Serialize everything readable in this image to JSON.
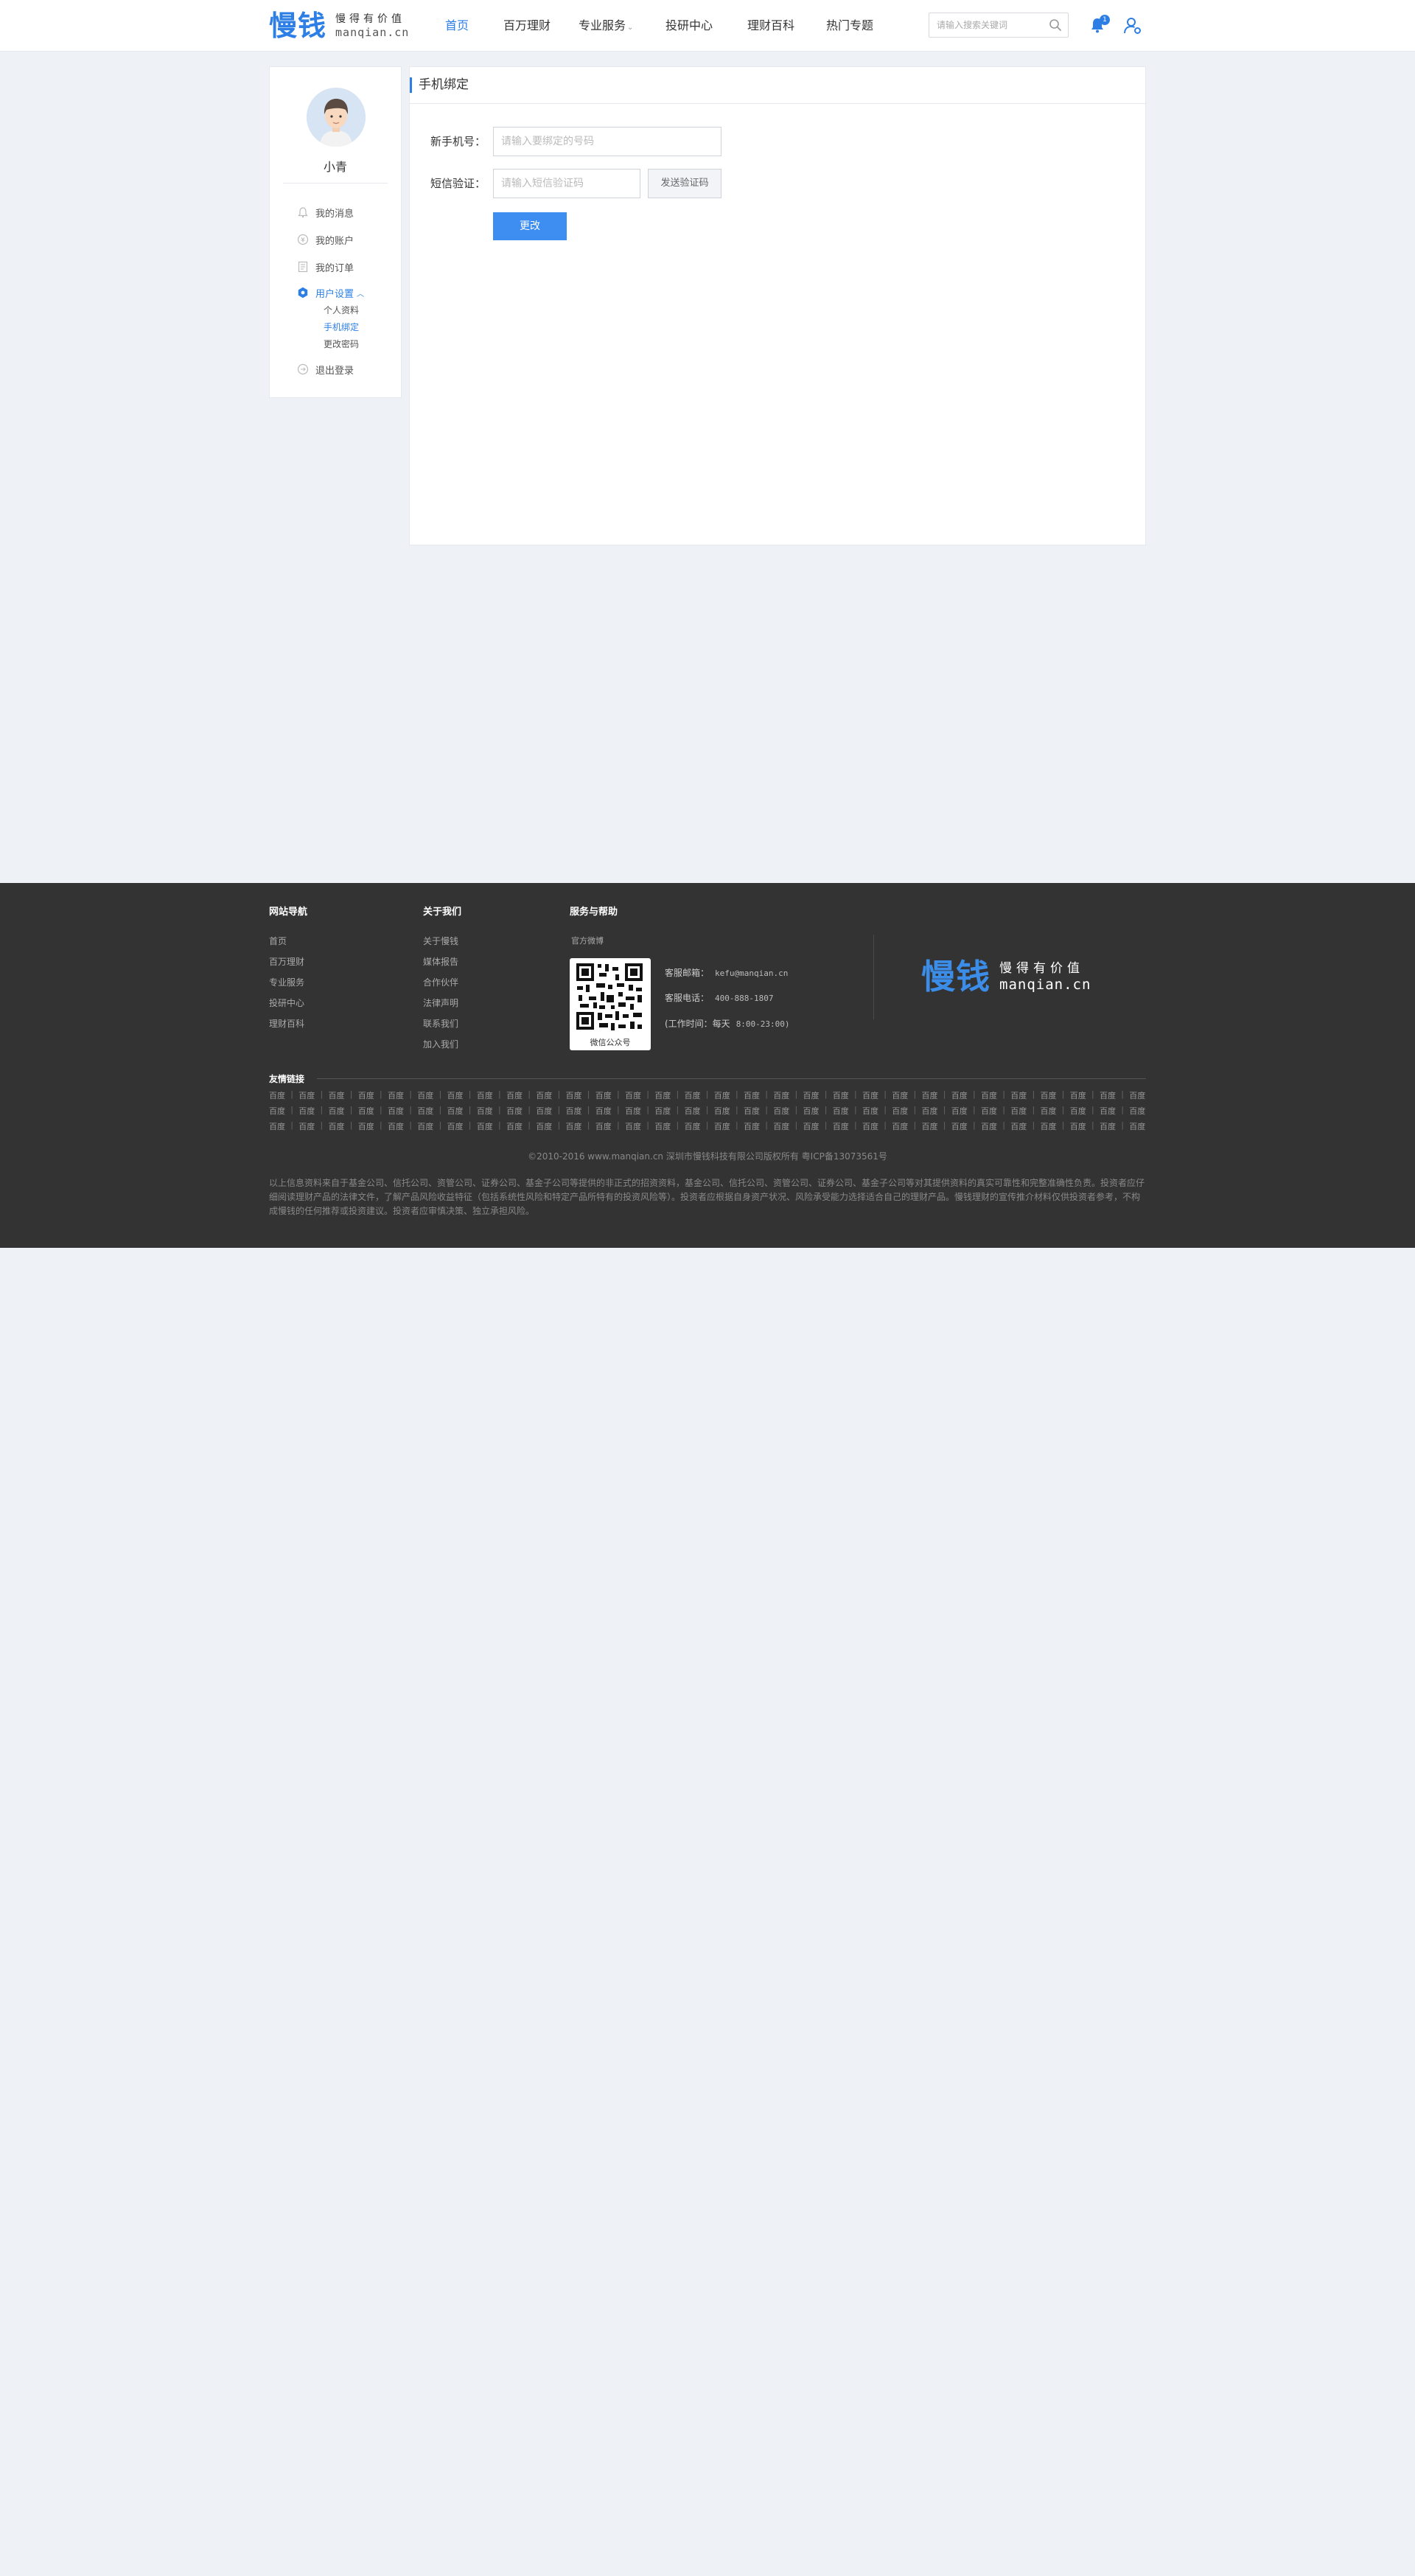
{
  "header": {
    "logo_text": "慢钱",
    "slogan": "慢得有价值",
    "domain": "manqian.cn",
    "nav": [
      {
        "label": "首页",
        "active": true
      },
      {
        "label": "百万理财",
        "active": false
      },
      {
        "label": "专业服务",
        "active": false,
        "has_dropdown": true
      },
      {
        "label": "投研中心",
        "active": false
      },
      {
        "label": "理财百科",
        "active": false
      },
      {
        "label": "热门专题",
        "active": false
      }
    ],
    "search_placeholder": "请输入搜索关键词",
    "notification_count": "1"
  },
  "sidebar": {
    "username": "小青",
    "items": [
      {
        "label": "我的消息",
        "icon": "bell-icon"
      },
      {
        "label": "我的账户",
        "icon": "account-icon"
      },
      {
        "label": "我的订单",
        "icon": "order-icon"
      },
      {
        "label": "用户设置",
        "icon": "settings-icon",
        "active": true,
        "expanded": true
      },
      {
        "label": "退出登录",
        "icon": "logout-icon"
      }
    ],
    "subitems": [
      {
        "label": "个人资料"
      },
      {
        "label": "手机绑定",
        "active": true
      },
      {
        "label": "更改密码"
      }
    ]
  },
  "panel": {
    "title": "手机绑定",
    "phone_label": "新手机号：",
    "phone_placeholder": "请输入要绑定的号码",
    "sms_label": "短信验证：",
    "sms_placeholder": "请输入短信验证码",
    "send_code_label": "发送验证码",
    "submit_label": "更改"
  },
  "footer": {
    "col1_title": "网站导航",
    "col1_links": [
      "首页",
      "百万理财",
      "专业服务",
      "投研中心",
      "理财百科"
    ],
    "col2_title": "关于我们",
    "col2_links": [
      "关于慢钱",
      "媒体报告",
      "合作伙伴",
      "法律声明",
      "联系我们",
      "加入我们"
    ],
    "col3_title": "服务与帮助",
    "weibo": "官方微博",
    "qr_caption": "微信公众号",
    "email_label": "客服邮箱：",
    "email": "kefu@manqian.cn",
    "phone_label": "客服电话：",
    "phone": "400-888-1807",
    "hours_label": "(工作时间：每天",
    "hours": "8:00-23:00)",
    "friend_links_title": "友情链接",
    "friend_link_text": "百度",
    "copyright": "©2010-2016 www.manqian.cn 深圳市慢钱科技有限公司版权所有    粤ICP备13073561号",
    "disclaimer": "以上信息资料来自于基金公司、信托公司、资管公司、证券公司、基金子公司等提供的非正式的招资资料，基金公司、信托公司、资管公司、证券公司、基金子公司等对其提供资料的真实可靠性和完整准确性负责。投资者应仔细阅读理财产品的法律文件，了解产品风险收益特征（包括系统性风险和特定产品所特有的投资风险等）。投资者应根据自身资产状况、风险承受能力选择适合自己的理财产品。慢钱理财的宣传推介材料仅供投资者参考，不构成慢钱的任何推荐或投资建议。投资者应审慎决策、独立承担风险。"
  }
}
